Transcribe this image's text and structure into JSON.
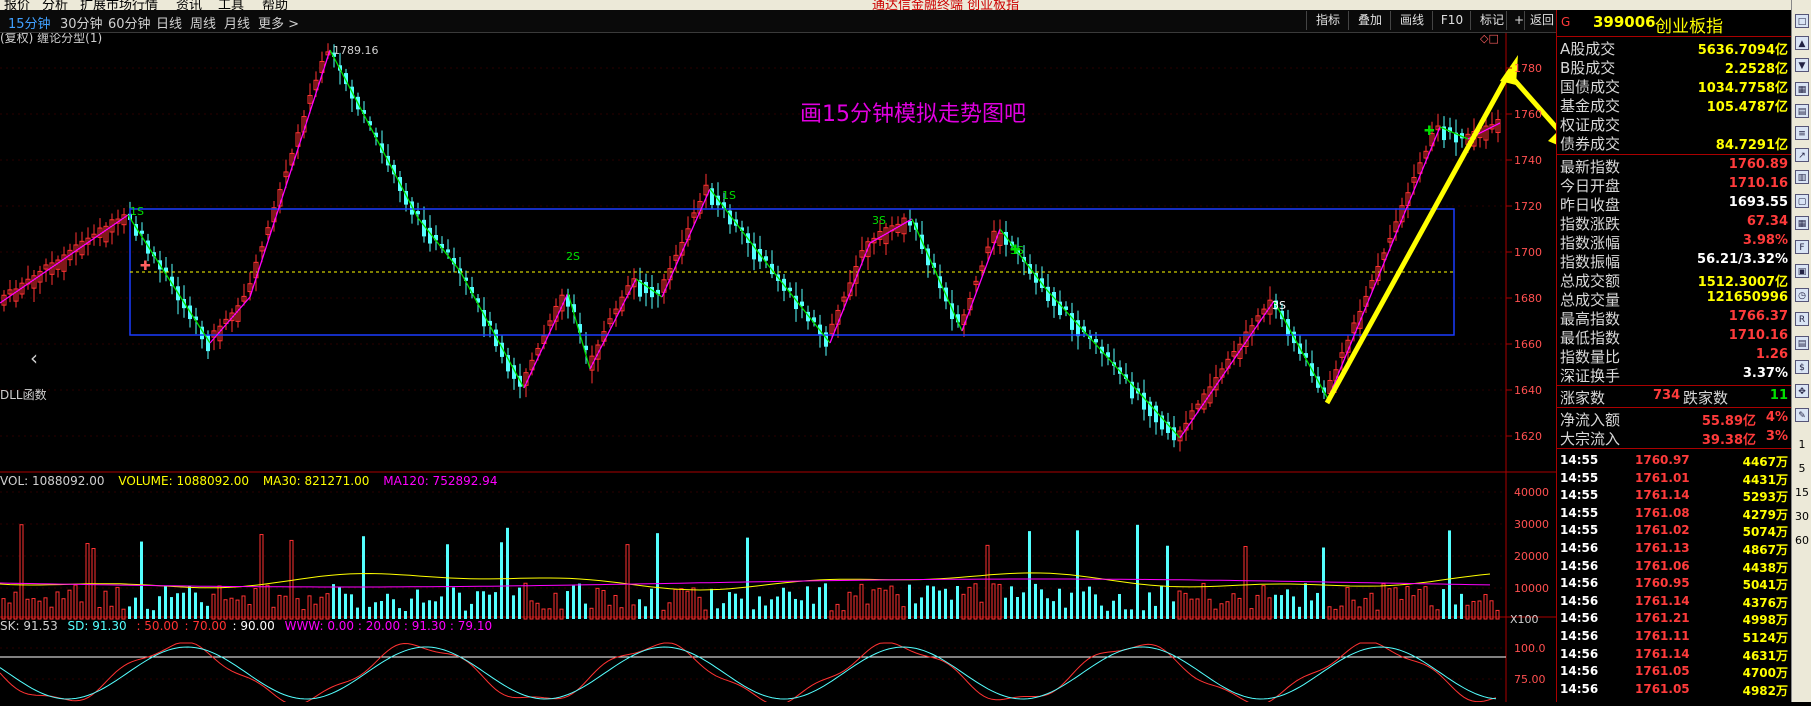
{
  "menubar": {
    "items": [
      "报价",
      "分析",
      "扩展市场行情",
      "资讯",
      "工具",
      "帮助"
    ],
    "center": "通达信金融终端  创业板指"
  },
  "periodbar": {
    "periods": [
      "15分钟",
      "30分钟",
      "60分钟",
      "日线",
      "周线",
      "月线",
      "更多 >"
    ],
    "active_index": 0,
    "tools": [
      "指标",
      "叠加",
      "画线",
      "F10",
      "标记",
      "+自选",
      "返回"
    ]
  },
  "chart": {
    "subtitle": "(复权) 缠论分型(1)",
    "annotation": "画15分钟模拟走势图吧",
    "high_label": "1789.16",
    "s_labels": [
      "1S",
      "1S",
      "2S",
      "3S",
      "3S",
      "3S"
    ],
    "price_axis": [
      "1780",
      "1760",
      "1740",
      "1720",
      "1700",
      "1680",
      "1660",
      "1640",
      "1620"
    ],
    "func_label": "DLL函数",
    "volume_legend": {
      "vol": "VOL: 1088092.00",
      "volume": "VOLUME: 1088092.00",
      "ma30": "MA30: 821271.00",
      "ma120": "MA120: 752892.94"
    },
    "volume_axis": [
      "40000",
      "30000",
      "20000",
      "10000"
    ],
    "volume_unit": "X100",
    "kd_legend": {
      "sk": "SK: 91.53",
      "sd": "SD: 91.30",
      "l1": ": 50.00",
      "l2": ": 70.00",
      "l3": ": 90.00",
      "www": "WWW: 0.00 : 20.00 : 91.30 : 79.10"
    },
    "kd_axis": [
      "100.0",
      "75.00"
    ],
    "colors": {
      "up": "#ff3232",
      "down": "#54ffff",
      "bi": "#ff00ff",
      "seg": "#00e000",
      "box": "#1a3cff",
      "arrow": "#ffff00",
      "ma30": "#ffff00",
      "ma120": "#ff00ff"
    }
  },
  "panel": {
    "code": "399006",
    "name": "创业板指",
    "flag": "G",
    "stats": [
      {
        "label": "A股成交",
        "value": "5636.7094亿",
        "color": "yellow"
      },
      {
        "label": "B股成交",
        "value": "2.2528亿",
        "color": "yellow"
      },
      {
        "label": "国债成交",
        "value": "1034.7758亿",
        "color": "yellow"
      },
      {
        "label": "基金成交",
        "value": "105.4787亿",
        "color": "yellow"
      },
      {
        "label": "权证成交",
        "value": "",
        "color": "yellow"
      },
      {
        "label": "债券成交",
        "value": "84.7291亿",
        "color": "yellow"
      }
    ],
    "quotes": [
      {
        "label": "最新指数",
        "value": "1760.89",
        "color": "red"
      },
      {
        "label": "今日开盘",
        "value": "1710.16",
        "color": "red"
      },
      {
        "label": "昨日收盘",
        "value": "1693.55",
        "color": "white"
      },
      {
        "label": "指数涨跌",
        "value": "67.34",
        "color": "red"
      },
      {
        "label": "指数涨幅",
        "value": "3.98%",
        "color": "red"
      },
      {
        "label": "指数振幅",
        "value": "56.21/3.32%",
        "color": "white"
      },
      {
        "label": "总成交额",
        "value": "1512.3007亿",
        "color": "yellow"
      },
      {
        "label": "总成交量",
        "value": "121650996",
        "color": "yellow"
      },
      {
        "label": "最高指数",
        "value": "1766.37",
        "color": "red"
      },
      {
        "label": "最低指数",
        "value": "1710.16",
        "color": "red"
      },
      {
        "label": "指数量比",
        "value": "1.26",
        "color": "red"
      },
      {
        "label": "深证换手",
        "value": "3.37%",
        "color": "white"
      }
    ],
    "breadth": {
      "up_label": "涨家数",
      "up_value": "734",
      "down_label": "跌家数",
      "down_value": "11"
    },
    "flows": [
      {
        "label": "净流入额",
        "value": "55.89亿",
        "pct": "4%"
      },
      {
        "label": "大宗流入",
        "value": "39.38亿",
        "pct": "3%"
      }
    ],
    "ticks": [
      {
        "time": "14:55",
        "price": "1760.97",
        "vol": "4467万"
      },
      {
        "time": "14:55",
        "price": "1761.01",
        "vol": "4431万"
      },
      {
        "time": "14:55",
        "price": "1761.14",
        "vol": "5293万"
      },
      {
        "time": "14:55",
        "price": "1761.08",
        "vol": "4279万"
      },
      {
        "time": "14:55",
        "price": "1761.02",
        "vol": "5074万"
      },
      {
        "time": "14:56",
        "price": "1761.13",
        "vol": "4867万"
      },
      {
        "time": "14:56",
        "price": "1761.06",
        "vol": "4438万"
      },
      {
        "time": "14:56",
        "price": "1760.95",
        "vol": "5041万"
      },
      {
        "time": "14:56",
        "price": "1761.14",
        "vol": "4376万"
      },
      {
        "time": "14:56",
        "price": "1761.21",
        "vol": "4998万"
      },
      {
        "time": "14:56",
        "price": "1761.11",
        "vol": "5124万"
      },
      {
        "time": "14:56",
        "price": "1761.14",
        "vol": "4631万"
      },
      {
        "time": "14:56",
        "price": "1761.05",
        "vol": "4700万"
      },
      {
        "time": "14:56",
        "price": "1761.05",
        "vol": "4982万"
      }
    ]
  },
  "iconbar": {
    "numbers": [
      "1",
      "5",
      "15",
      "30",
      "60"
    ]
  }
}
